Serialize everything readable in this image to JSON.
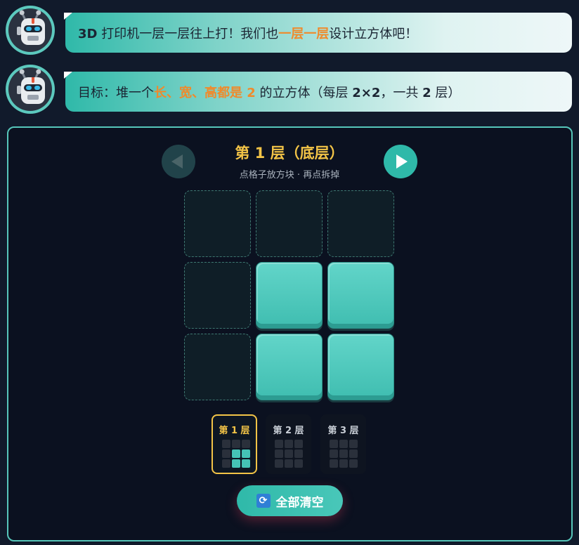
{
  "messages": [
    {
      "parts": [
        {
          "text": "3D",
          "style": "b"
        },
        {
          "text": " 打印机一层一层往上打！我们也",
          "style": ""
        },
        {
          "text": "一层一层",
          "style": "hl"
        },
        {
          "text": "设计立方体吧！",
          "style": ""
        }
      ]
    },
    {
      "parts": [
        {
          "text": "目标：堆一个",
          "style": ""
        },
        {
          "text": "长、宽、高都是 2",
          "style": "hl"
        },
        {
          "text": " 的立方体（每层 ",
          "style": ""
        },
        {
          "text": "2×2",
          "style": "b"
        },
        {
          "text": "，一共 ",
          "style": ""
        },
        {
          "text": "2",
          "style": "b"
        },
        {
          "text": " 层）",
          "style": ""
        }
      ]
    }
  ],
  "layer": {
    "title": "第 1 层（底层）",
    "hint": "点格子放方块 · 再点拆掉"
  },
  "grid": [
    [
      0,
      0,
      0
    ],
    [
      0,
      1,
      1
    ],
    [
      0,
      1,
      1
    ]
  ],
  "tabs": [
    {
      "label": "第 1 层",
      "active": true,
      "cells": [
        0,
        0,
        0,
        0,
        1,
        1,
        0,
        1,
        1
      ]
    },
    {
      "label": "第 2 层",
      "active": false,
      "cells": [
        0,
        0,
        0,
        0,
        0,
        0,
        0,
        0,
        0
      ]
    },
    {
      "label": "第 3 层",
      "active": false,
      "cells": [
        0,
        0,
        0,
        0,
        0,
        0,
        0,
        0,
        0
      ]
    }
  ],
  "clear_button": {
    "icon": "refresh-icon",
    "label": "全部清空"
  },
  "colors": {
    "accent": "#2fb9a9",
    "highlight": "#f08a2b",
    "gold": "#f3c447"
  }
}
